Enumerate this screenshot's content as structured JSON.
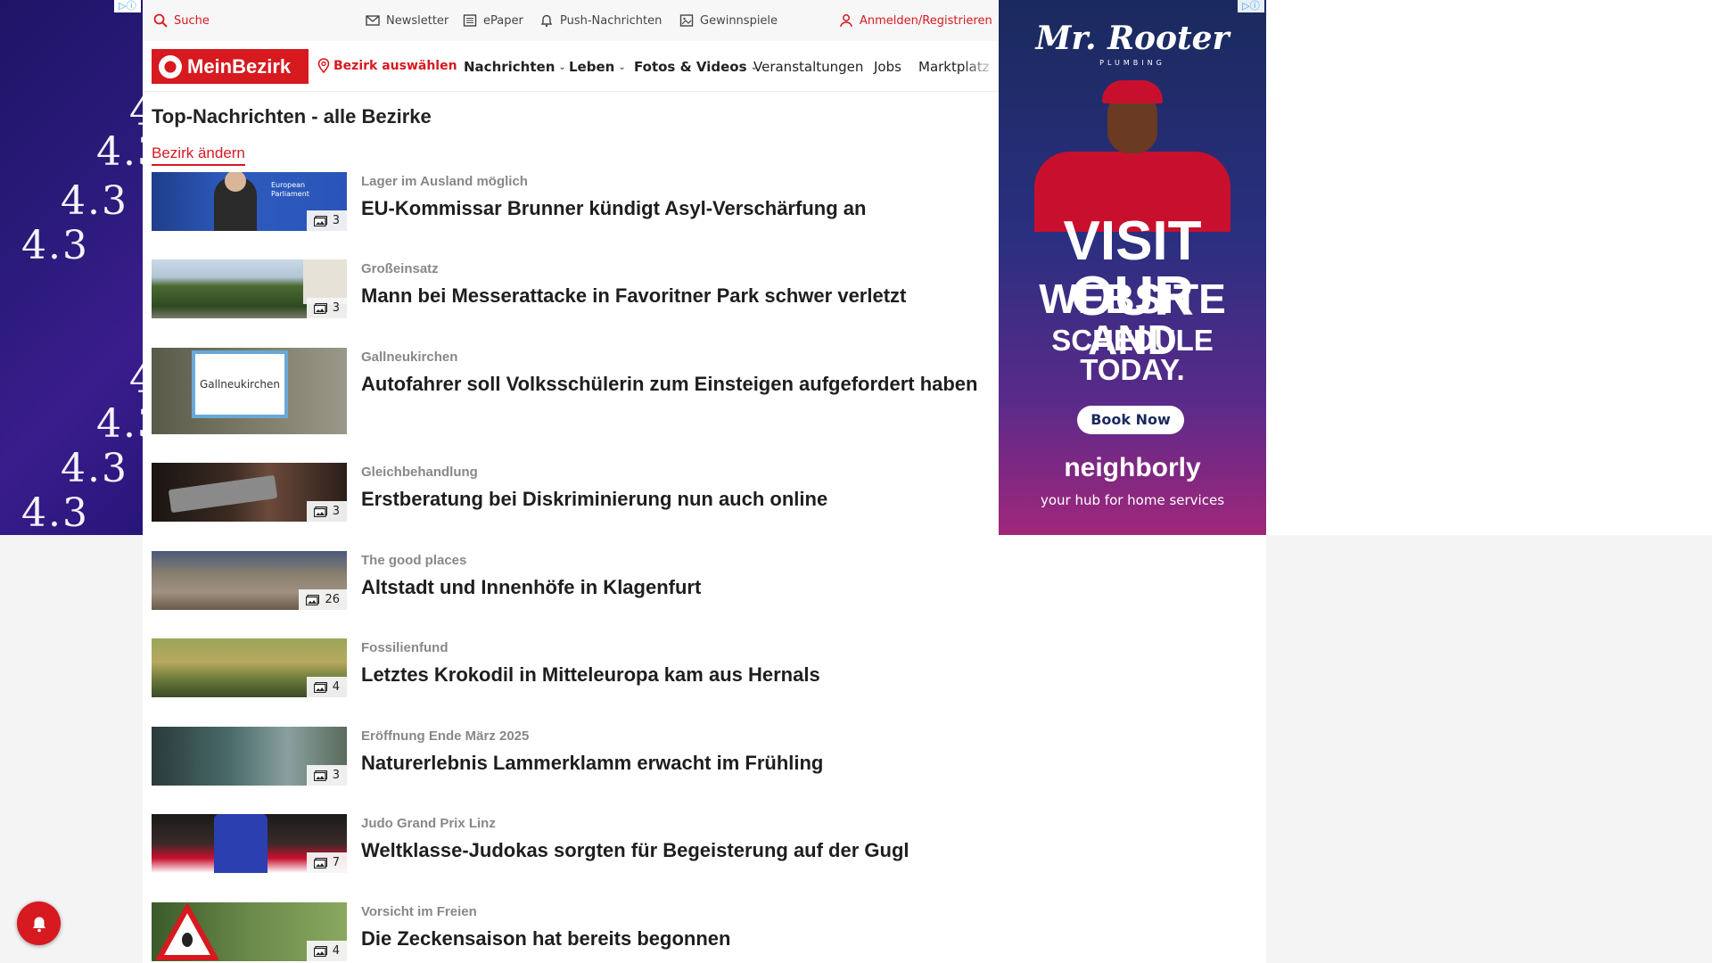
{
  "topbar": {
    "search": "Suche",
    "newsletter": "Newsletter",
    "epaper": "ePaper",
    "push": "Push-Nachrichten",
    "gewinnspiele": "Gewinnspiele",
    "login": "Anmelden/Registrieren"
  },
  "nav": {
    "logo": "MeinBezirk",
    "bezirk": "Bezirk auswählen",
    "items": [
      {
        "label": "Nachrichten",
        "has_menu": true
      },
      {
        "label": "Leben",
        "has_menu": true
      },
      {
        "label": "Fotos & Videos",
        "has_menu": true
      },
      {
        "label": "Veranstaltungen",
        "has_menu": false
      },
      {
        "label": "Jobs",
        "has_menu": false
      },
      {
        "label": "Marktplatz",
        "has_menu": false
      }
    ]
  },
  "page": {
    "title": "Top-Nachrichten - alle Bezirke",
    "change_link": "Bezirk ändern"
  },
  "articles": [
    {
      "kicker": "Lager im Ausland möglich",
      "headline": "EU-Kommissar Brunner kündigt Asyl-Verschärfung an",
      "count": "3"
    },
    {
      "kicker": "Großeinsatz",
      "headline": "Mann bei Messerattacke in Favoritner Park schwer verletzt",
      "count": "3"
    },
    {
      "kicker": "Gallneukirchen",
      "headline": "Autofahrer soll Volksschülerin zum Einsteigen aufgefordert haben",
      "count": ""
    },
    {
      "kicker": "Gleichbehandlung",
      "headline": "Erstberatung bei Diskriminierung nun auch online",
      "count": "3"
    },
    {
      "kicker": "The good places",
      "headline": "Altstadt und Innenhöfe in Klagenfurt",
      "count": "26"
    },
    {
      "kicker": "Fossilienfund",
      "headline": "Letztes Krokodil in Mitteleuropa kam aus Hernals",
      "count": "4"
    },
    {
      "kicker": "Eröffnung Ende März 2025",
      "headline": "Naturerlebnis Lammerklamm erwacht im Frühling",
      "count": "3"
    },
    {
      "kicker": "Judo Grand Prix Linz",
      "headline": "Weltklasse-Judokas sorgten für Begeisterung auf der Gugl",
      "count": "7"
    },
    {
      "kicker": "Vorsicht im Freien",
      "headline": "Die Zeckensaison hat bereits begonnen",
      "count": "4"
    }
  ],
  "thumb_text": {
    "eu": "European Parliament",
    "sign": "Gallneukirchen"
  },
  "ad_right": {
    "brand": "Mr. Rooter",
    "sub": "PLUMBING",
    "line1": "VISIT OUR",
    "line2": "WEBSITE AND",
    "line3": "SCHEDULE TODAY.",
    "button": "Book Now",
    "network": "neighborly",
    "tagline": "your hub for home services"
  },
  "ad_left": {
    "glyph": "4.3"
  },
  "colors": {
    "brand_red": "#d71920",
    "skin_blue": "#2a1a7a"
  }
}
